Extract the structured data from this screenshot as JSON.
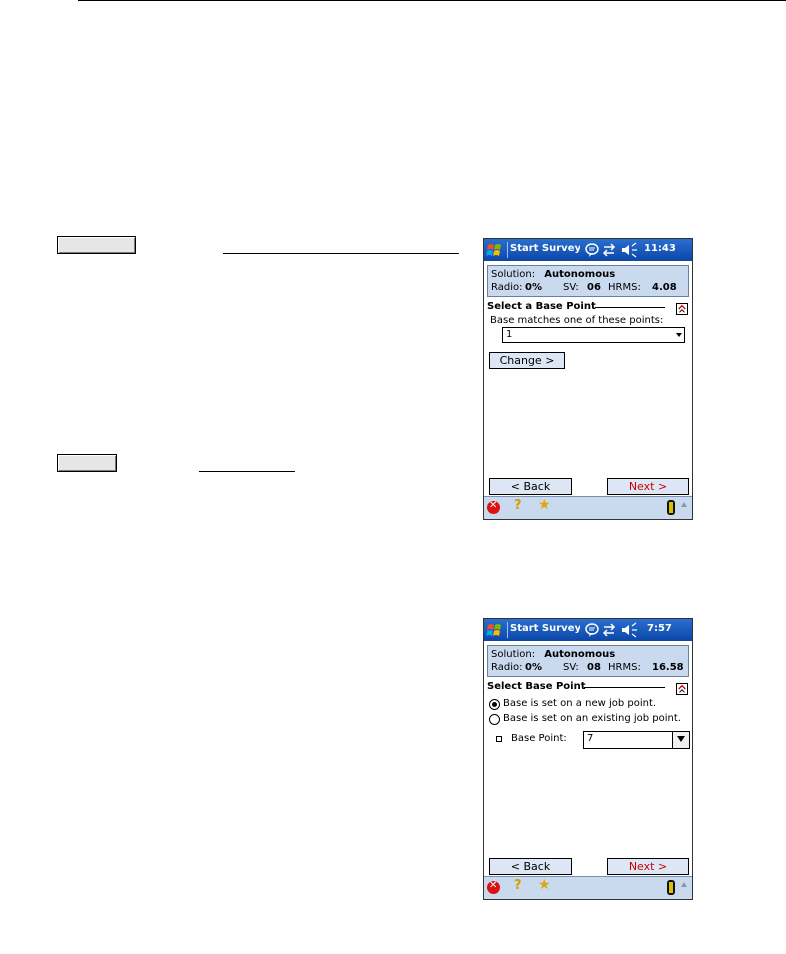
{
  "screens": [
    {
      "title": "Start Survey \\",
      "time": "11:43",
      "status": {
        "solution_label": "Solution:",
        "solution_value": "Autonomous",
        "radio_label": "Radio:",
        "radio_value": "0%",
        "sv_label": "SV:",
        "sv_value": "06",
        "hrms_label": "HRMS:",
        "hrms_value": "4.08"
      },
      "section_title": "Select a Base Point",
      "prompt": "Base matches one of these points:",
      "combo_value": "1",
      "change_button": "Change >",
      "back_button": "< Back",
      "next_button": "Next >"
    },
    {
      "title": "Start Survey W",
      "time": "7:57",
      "status": {
        "solution_label": "Solution:",
        "solution_value": "Autonomous",
        "radio_label": "Radio:",
        "radio_value": "0%",
        "sv_label": "SV:",
        "sv_value": "08",
        "hrms_label": "HRMS:",
        "hrms_value": "16.58"
      },
      "section_title": "Select Base Point",
      "radio_new": "Base is set on a new job point.",
      "radio_existing": "Base is set on an existing job point.",
      "radio_selected": "new",
      "base_point_label": "Base Point:",
      "base_point_value": "7",
      "back_button": "< Back",
      "next_button": "Next >"
    }
  ],
  "icons": {
    "start": "windows-flag-icon",
    "connectivity": "speech-bubble-icon",
    "sync": "sync-arrows-icon",
    "volume": "speaker-icon",
    "help": "help-question-icon",
    "close": "close-icon",
    "favorites": "star-icon",
    "gps": "gps-battery-icon"
  }
}
